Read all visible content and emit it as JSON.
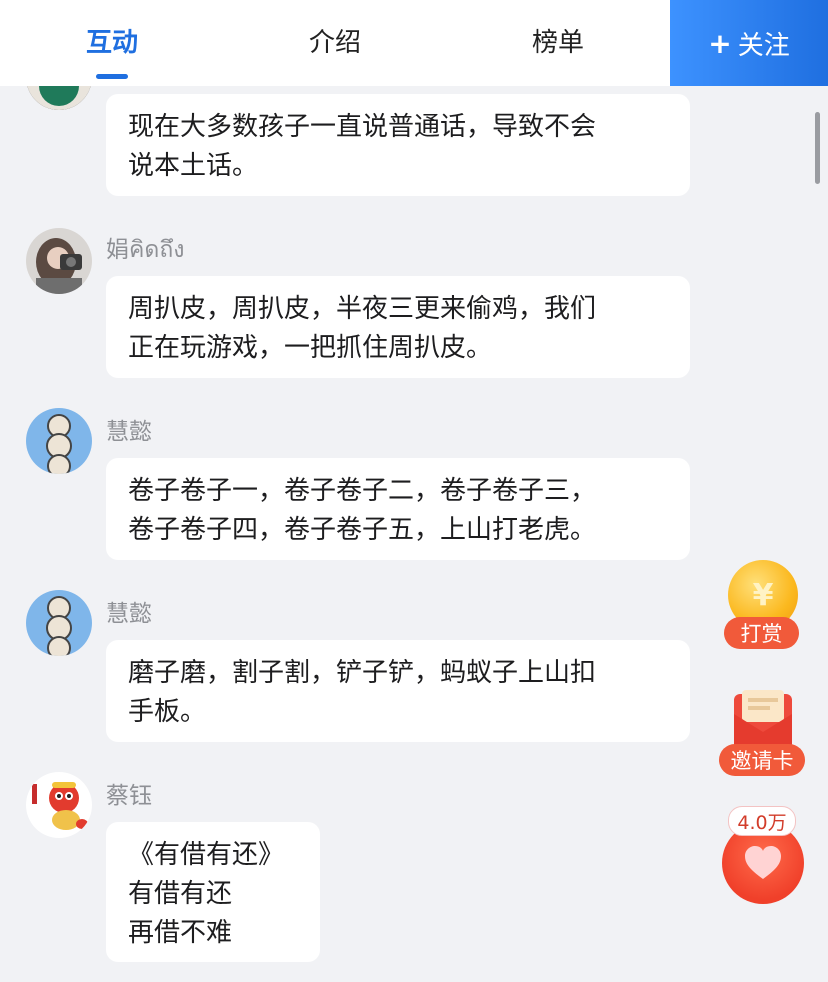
{
  "tabs": {
    "interact": "互动",
    "intro": "介绍",
    "ranking": "榜单"
  },
  "follow": {
    "plus": "+",
    "label": "关注"
  },
  "comments": [
    {
      "username": "",
      "text_lines": [
        "现在大多数孩子一直说普通话，导致不会",
        "说本土话。"
      ]
    },
    {
      "username": "娟คิดถึง",
      "text_lines": [
        "周扒皮，周扒皮，半夜三更来偷鸡，我们",
        "正在玩游戏，一把抓住周扒皮。"
      ]
    },
    {
      "username": "慧懿",
      "text_lines": [
        "卷子卷子一，卷子卷子二，卷子卷子三，",
        "卷子卷子四，卷子卷子五，上山打老虎。"
      ]
    },
    {
      "username": "慧懿",
      "text_lines": [
        "磨子磨，割子割，铲子铲，蚂蚁子上山扣",
        "手板。"
      ]
    },
    {
      "username": "蔡钰",
      "text_lines": [
        "《有借有还》",
        "有借有还",
        "再借不难"
      ]
    }
  ],
  "widgets": {
    "tip_label": "打赏",
    "tip_icon": "yuan-coin-icon",
    "invite_label": "邀请卡",
    "invite_icon": "red-envelope-icon",
    "like_count": "4.0万",
    "like_icon": "heart-icon"
  },
  "colors": {
    "accent": "#1f6fe0",
    "background": "#f1f2f5",
    "bubble": "#ffffff",
    "widget_red": "#f15a3a"
  }
}
